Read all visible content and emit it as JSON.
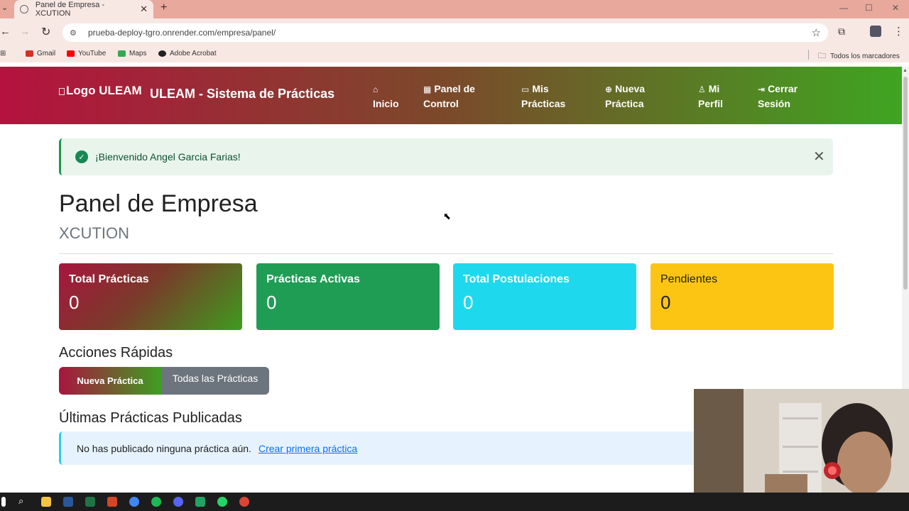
{
  "browser": {
    "tab_title": "Panel de Empresa - XCUTION",
    "tab_close": "✕",
    "new_tab": "+",
    "url": "prueba-deploy-tgro.onrender.com/empresa/panel/",
    "bookmarks": [
      {
        "label": "Gmail",
        "color": "#d93025"
      },
      {
        "label": "YouTube",
        "color": "#ff0000"
      },
      {
        "label": "Maps",
        "color": "#34a853"
      },
      {
        "label": "Adobe Acrobat",
        "color": "#222222"
      }
    ],
    "all_bookmarks": "Todos los marcadores"
  },
  "nav": {
    "logo_alt": "Logo ULEAM",
    "site_title": "ULEAM - Sistema de Prácticas",
    "items": [
      {
        "icon": "home-icon",
        "line1": "Inicio",
        "line2": ""
      },
      {
        "icon": "grid-icon",
        "line1": "Panel de",
        "line2": "Control"
      },
      {
        "icon": "briefcase-icon",
        "line1": "Mis",
        "line2": "Prácticas"
      },
      {
        "icon": "plus-circle-icon",
        "line1": "Nueva",
        "line2": "Práctica"
      },
      {
        "icon": "user-icon",
        "line1": "Mi",
        "line2": "Perfil"
      },
      {
        "icon": "logout-icon",
        "line1": "Cerrar",
        "line2": "Sesión"
      }
    ],
    "gradient": [
      "#b5123f",
      "#3ea521"
    ]
  },
  "alert": {
    "message": "¡Bienvenido Angel Garcia Farias!",
    "close": "✕"
  },
  "page": {
    "title": "Panel de Empresa",
    "company": "XCUTION"
  },
  "stats": [
    {
      "label": "Total Prácticas",
      "value": "0",
      "color": "gradient"
    },
    {
      "label": "Prácticas Activas",
      "value": "0",
      "color": "#1f9d55"
    },
    {
      "label": "Total Postulaciones",
      "value": "0",
      "color": "#1ed9ee"
    },
    {
      "label": "Pendientes",
      "value": "0",
      "color": "#fcc514"
    }
  ],
  "quick_actions": {
    "title": "Acciones Rápidas",
    "new_label": "Nueva Práctica",
    "all_label": "Todas las Prácticas"
  },
  "latest": {
    "title": "Últimas Prácticas Publicadas",
    "empty_text": "No has publicado ninguna práctica aún.",
    "create_link": "Crear primera práctica"
  }
}
